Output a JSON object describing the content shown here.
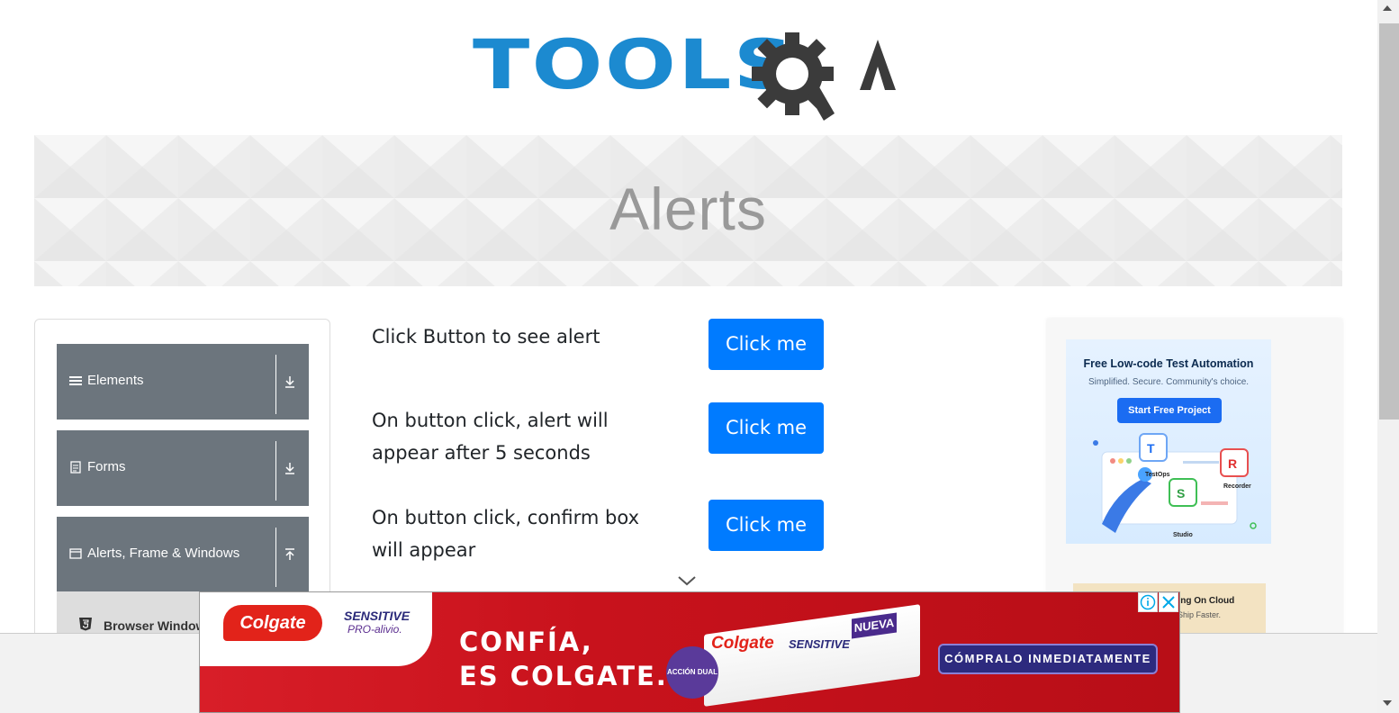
{
  "logo": {
    "wordmark": "TOOLS",
    "suffix": "QA"
  },
  "banner": {
    "title": "Alerts"
  },
  "sidebar": {
    "groups": [
      {
        "label": "Elements",
        "icon": "hamburger-icon",
        "toggle": "download-arrow-icon"
      },
      {
        "label": "Forms",
        "icon": "document-icon",
        "toggle": "download-arrow-icon"
      },
      {
        "label": "Alerts, Frame & Windows",
        "icon": "window-icon",
        "toggle": "upload-arrow-icon"
      }
    ],
    "subitem": {
      "label": "Browser Windows",
      "icon": "html5-icon"
    }
  },
  "main": {
    "rows": [
      {
        "text": "Click Button to see alert",
        "button": "Click me"
      },
      {
        "text": "On button click, alert will appear after 5 seconds",
        "button": "Click me"
      },
      {
        "text": "On button click, confirm box will appear",
        "button": "Click me"
      }
    ]
  },
  "right_ad": {
    "headline": "Free Low-code Test Automation",
    "subline": "Simplified. Secure. Community's choice.",
    "cta": "Start Free Project",
    "labels": [
      "TestOps",
      "Recorder",
      "Studio"
    ],
    "second_headline": "esting On Cloud",
    "second_subline": "e. Ship Faster."
  },
  "bottom_ad": {
    "brand": "Colgate",
    "product": "SENSITIVE",
    "product_line": "PRO-alivio.",
    "badge": "NUEVA",
    "slogan_line1": "CONFÍA,",
    "slogan_line2": "ES COLGATE.",
    "seal": "ACCIÓN DUAL",
    "cta": "CÓMPRALO INMEDIATAMENTE",
    "adchoices_icon": "info-icon",
    "close_icon": "close-icon"
  },
  "colors": {
    "primary_button": "#007bff",
    "nav_group_bg": "#6c757d",
    "logo_blue": "#1c8ad0",
    "logo_dark": "#3b3b3b",
    "ad_red": "#d81e28"
  }
}
